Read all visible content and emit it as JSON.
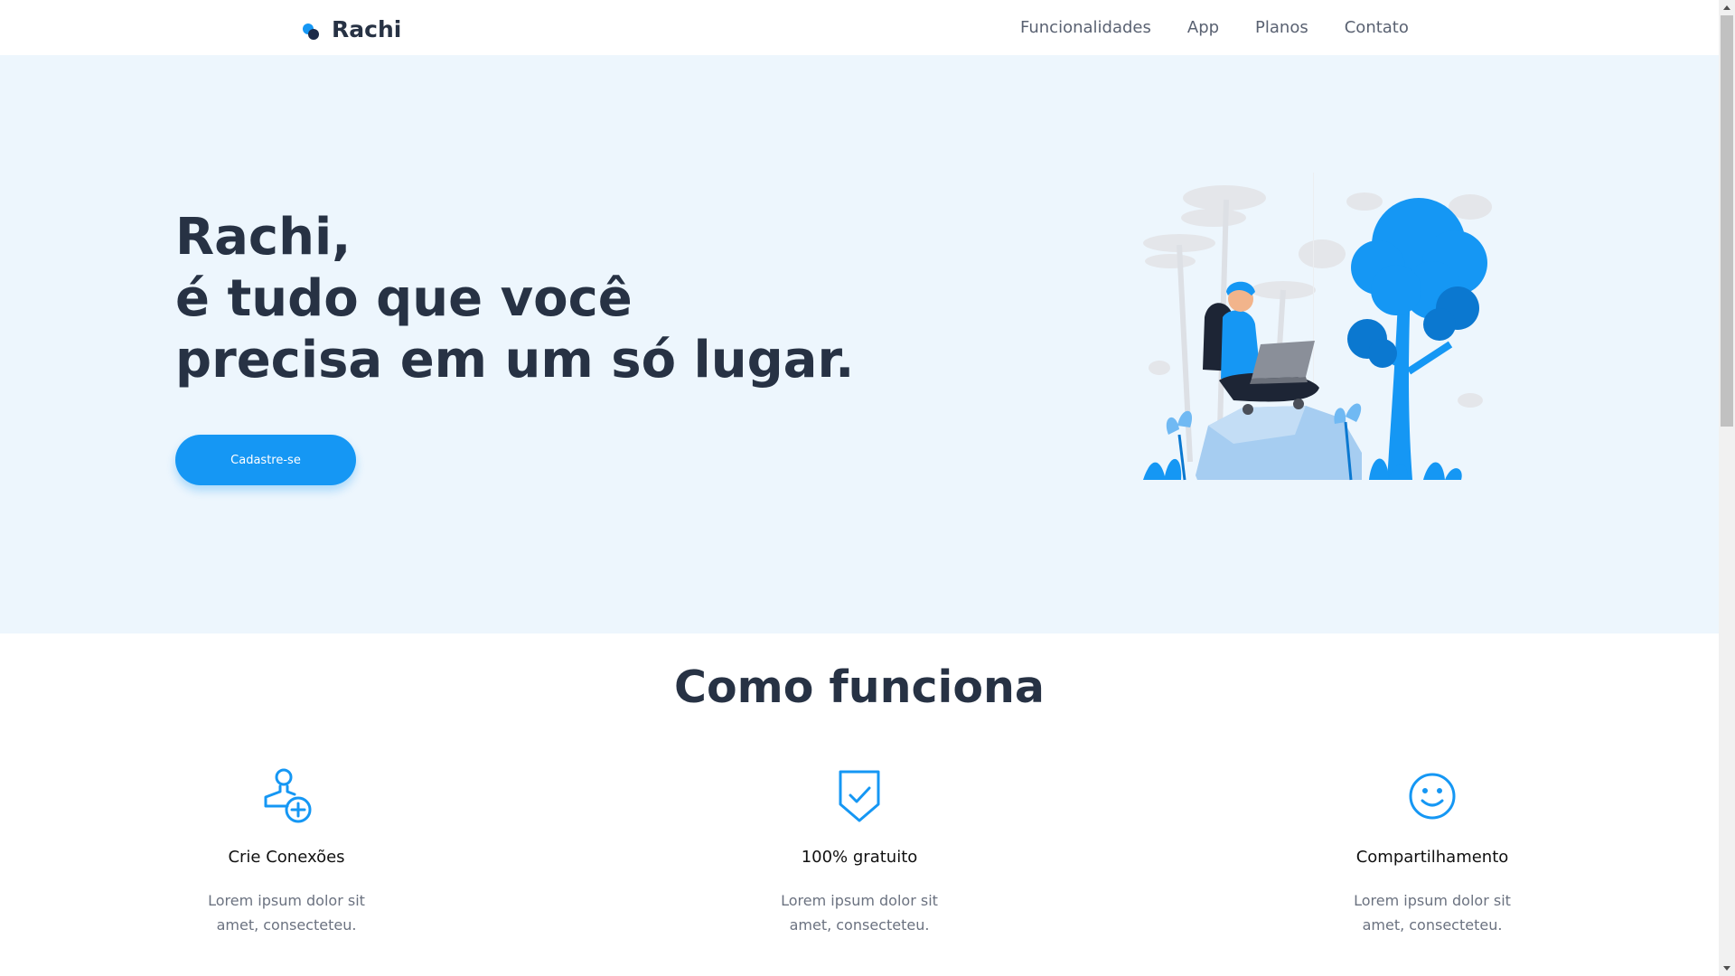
{
  "brand": {
    "name": "Rachi"
  },
  "nav": [
    "Funcionalidades",
    "App",
    "Planos",
    "Contato"
  ],
  "hero": {
    "title_lines": [
      "Rachi,",
      "é tudo que você",
      "precisa em um só lugar."
    ],
    "cta_label": "Cadastre-se"
  },
  "how": {
    "title": "Como funciona",
    "features": [
      {
        "icon": "add-user-icon",
        "title": "Crie Conexões",
        "desc_lines": [
          "Lorem ipsum dolor sit",
          "amet, consecteteu."
        ]
      },
      {
        "icon": "shield-check-icon",
        "title": "100% gratuito",
        "desc_lines": [
          "Lorem ipsum dolor sit",
          "amet, consecteteu."
        ]
      },
      {
        "icon": "smile-icon",
        "title": "Compartilhamento",
        "desc_lines": [
          "Lorem ipsum dolor sit",
          "amet, consecteteu."
        ]
      }
    ]
  },
  "colors": {
    "accent": "#1597f4",
    "hero_bg": "#edf6fd",
    "text_dark": "#273244"
  }
}
